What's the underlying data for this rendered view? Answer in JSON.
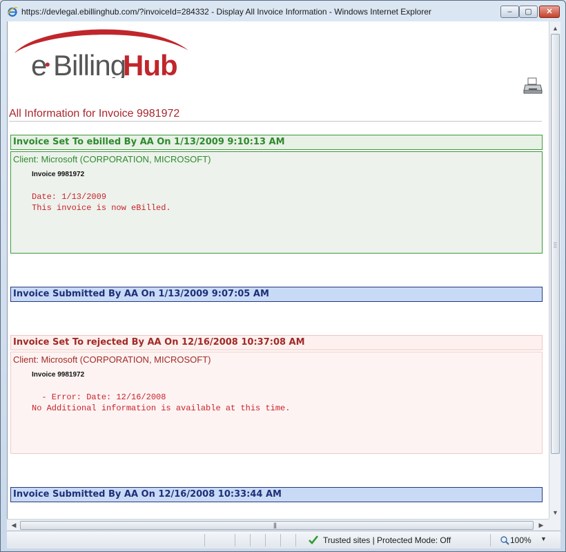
{
  "window": {
    "title": "https://devlegal.ebillinghub.com/?invoiceId=284332 - Display All Invoice Information - Windows Internet Explorer",
    "minimize": "–",
    "maximize": "▢",
    "close": "✕"
  },
  "logo": {
    "e": "e",
    "dot": "•",
    "billing": "Billing",
    "hub": "Hub"
  },
  "page": {
    "title": "All Information for Invoice 9981972"
  },
  "events": [
    {
      "header": "Invoice Set To ebilled By AA On 1/13/2009 9:10:13 AM",
      "client": "Client: Microsoft (CORPORATION, MICROSOFT)",
      "invoice": "Invoice 9981972",
      "line1": "Date: 1/13/2009",
      "line2": "This invoice is now eBilled."
    },
    {
      "header": "Invoice Submitted By AA On 1/13/2009 9:07:05 AM"
    },
    {
      "header": "Invoice Set To rejected By AA On 12/16/2008 10:37:08 AM",
      "client": "Client: Microsoft (CORPORATION, MICROSOFT)",
      "invoice": "Invoice 9981972",
      "line1": "  - Error: Date: 12/16/2008",
      "line2": "No Additional information is available at this time."
    },
    {
      "header": "Invoice Submitted By AA On 12/16/2008 10:33:44 AM"
    }
  ],
  "statusbar": {
    "zone": "Trusted sites | Protected Mode: Off",
    "zoom": "100%"
  },
  "colors": {
    "brand_red": "#a8262c",
    "green": "#2d8a2d",
    "blue": "#1f2f78",
    "error_red": "#c8232c"
  }
}
